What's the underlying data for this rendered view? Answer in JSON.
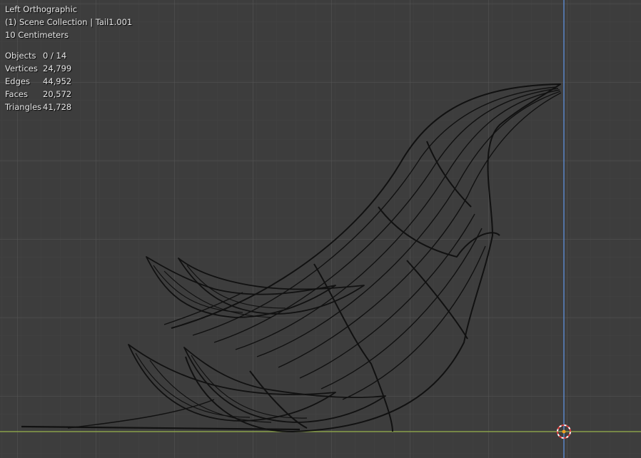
{
  "viewport": {
    "view_name": "Left Orthographic",
    "collection_label": "(1) Scene Collection | Tail1.001",
    "scale_label": "10 Centimeters",
    "stats": [
      {
        "label": "Objects",
        "value": "0 / 14"
      },
      {
        "label": "Vertices",
        "value": "24,799"
      },
      {
        "label": "Edges",
        "value": "44,952"
      },
      {
        "label": "Faces",
        "value": "20,572"
      },
      {
        "label": "Triangles",
        "value": "41,728"
      }
    ],
    "colors": {
      "background": "#3d3d3d",
      "grid_minor": "#444444",
      "grid_major": "#555555",
      "axis_z": "#5a85c6",
      "axis_y": "#8aa04a",
      "wire": "#111111"
    },
    "icons": {
      "cursor": "3d-cursor-icon"
    }
  }
}
